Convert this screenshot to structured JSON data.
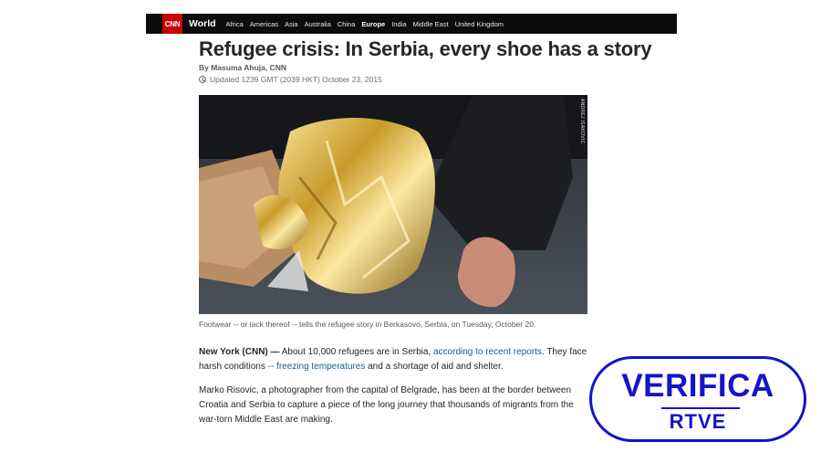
{
  "nav": {
    "logo": "CNN",
    "section": "World",
    "items": [
      "Africa",
      "Americas",
      "Asia",
      "Australia",
      "China",
      "Europe",
      "India",
      "Middle East",
      "United Kingdom"
    ],
    "active": "Europe"
  },
  "article": {
    "headline": "Refugee crisis: In Serbia, every shoe has a story",
    "byline": "By Masuma Ahuja, CNN",
    "updated": "Updated 1239 GMT (2039 HKT) October 23, 2015",
    "photo_credit": "ANDREJ ISAKOVIC",
    "caption": "Footwear -- or lack thereof -- tells the refugee story in Berkasovo, Serbia, on Tuesday, October 20.",
    "p1": {
      "dateline": "New York (CNN) —",
      "text1": " About 10,000 refugees are in Serbia, ",
      "link1": "according to recent reports",
      "text2": ". They face harsh conditions ",
      "link2": "-- freezing temperatures",
      "text3": " and a shortage of aid and shelter."
    },
    "p2": "Marko Risovic, a photographer from the capital of Belgrade, has been at the border between Croatia and Serbia to capture a piece of the long journey that thousands of migrants from the war-torn Middle East are making."
  },
  "watermark": {
    "title": "VERIFICA",
    "subtitle": "RTVE"
  },
  "colors": {
    "cnn_red": "#cc0000",
    "nav_bg": "#0c0c0c",
    "link": "#1e5a96",
    "rtve_blue": "#1414c8"
  }
}
